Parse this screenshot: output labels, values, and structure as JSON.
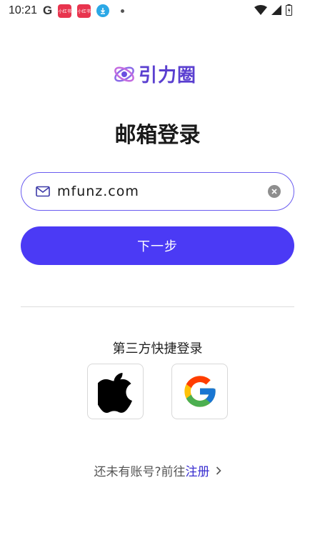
{
  "status_bar": {
    "time": "10:21",
    "app_badge_1": "小红书",
    "app_badge_2": "小红书"
  },
  "brand": {
    "name": "引力圈",
    "color": "#5a3fd0"
  },
  "page": {
    "title": "邮箱登录"
  },
  "email_input": {
    "value": "mfunz.com",
    "placeholder": ""
  },
  "next_button": {
    "label": "下一步",
    "color": "#4b3af5"
  },
  "third_party": {
    "label": "第三方快捷登录",
    "providers": [
      "apple-icon",
      "google-icon"
    ]
  },
  "register": {
    "prompt": "还未有账号?前往",
    "link_label": "注册"
  }
}
